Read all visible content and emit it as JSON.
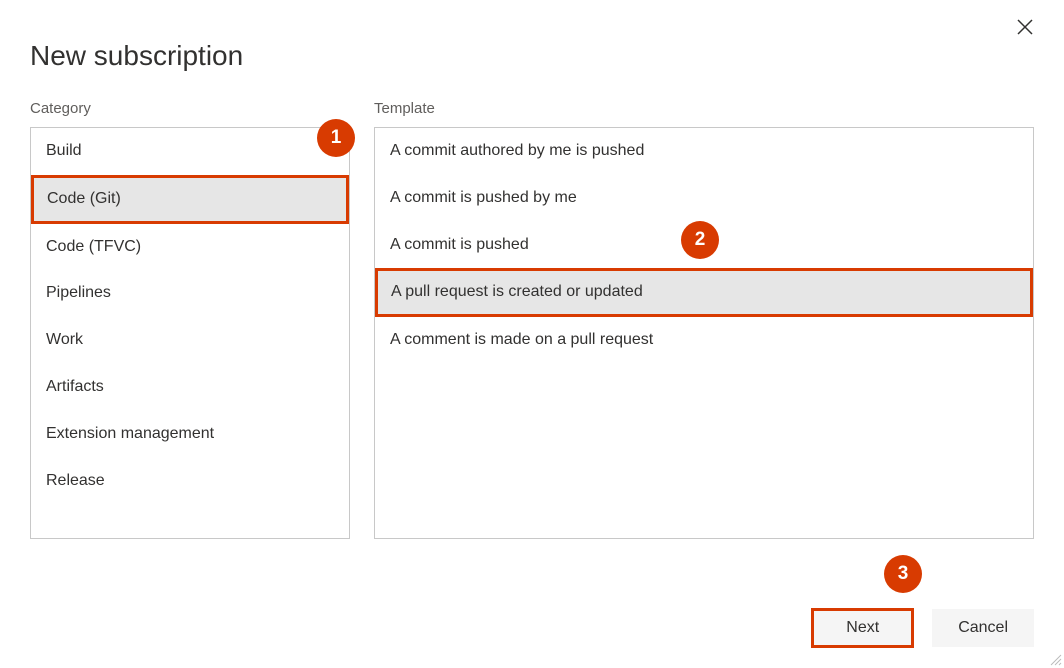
{
  "dialog": {
    "title": "New subscription",
    "close_label": "Close"
  },
  "columns": {
    "category": {
      "label": "Category"
    },
    "template": {
      "label": "Template"
    }
  },
  "categories": [
    {
      "label": "Build"
    },
    {
      "label": "Code (Git)"
    },
    {
      "label": "Code (TFVC)"
    },
    {
      "label": "Pipelines"
    },
    {
      "label": "Work"
    },
    {
      "label": "Artifacts"
    },
    {
      "label": "Extension management"
    },
    {
      "label": "Release"
    }
  ],
  "templates": [
    {
      "label": "A commit authored by me is pushed"
    },
    {
      "label": "A commit is pushed by me"
    },
    {
      "label": "A commit is pushed"
    },
    {
      "label": "A pull request is created or updated"
    },
    {
      "label": "A comment is made on a pull request"
    }
  ],
  "callouts": {
    "c1": "1",
    "c2": "2",
    "c3": "3"
  },
  "buttons": {
    "next": "Next",
    "cancel": "Cancel"
  },
  "colors": {
    "accent": "#d83b01",
    "selected_bg": "#e6e6e6",
    "border": "#c8c8c8"
  }
}
